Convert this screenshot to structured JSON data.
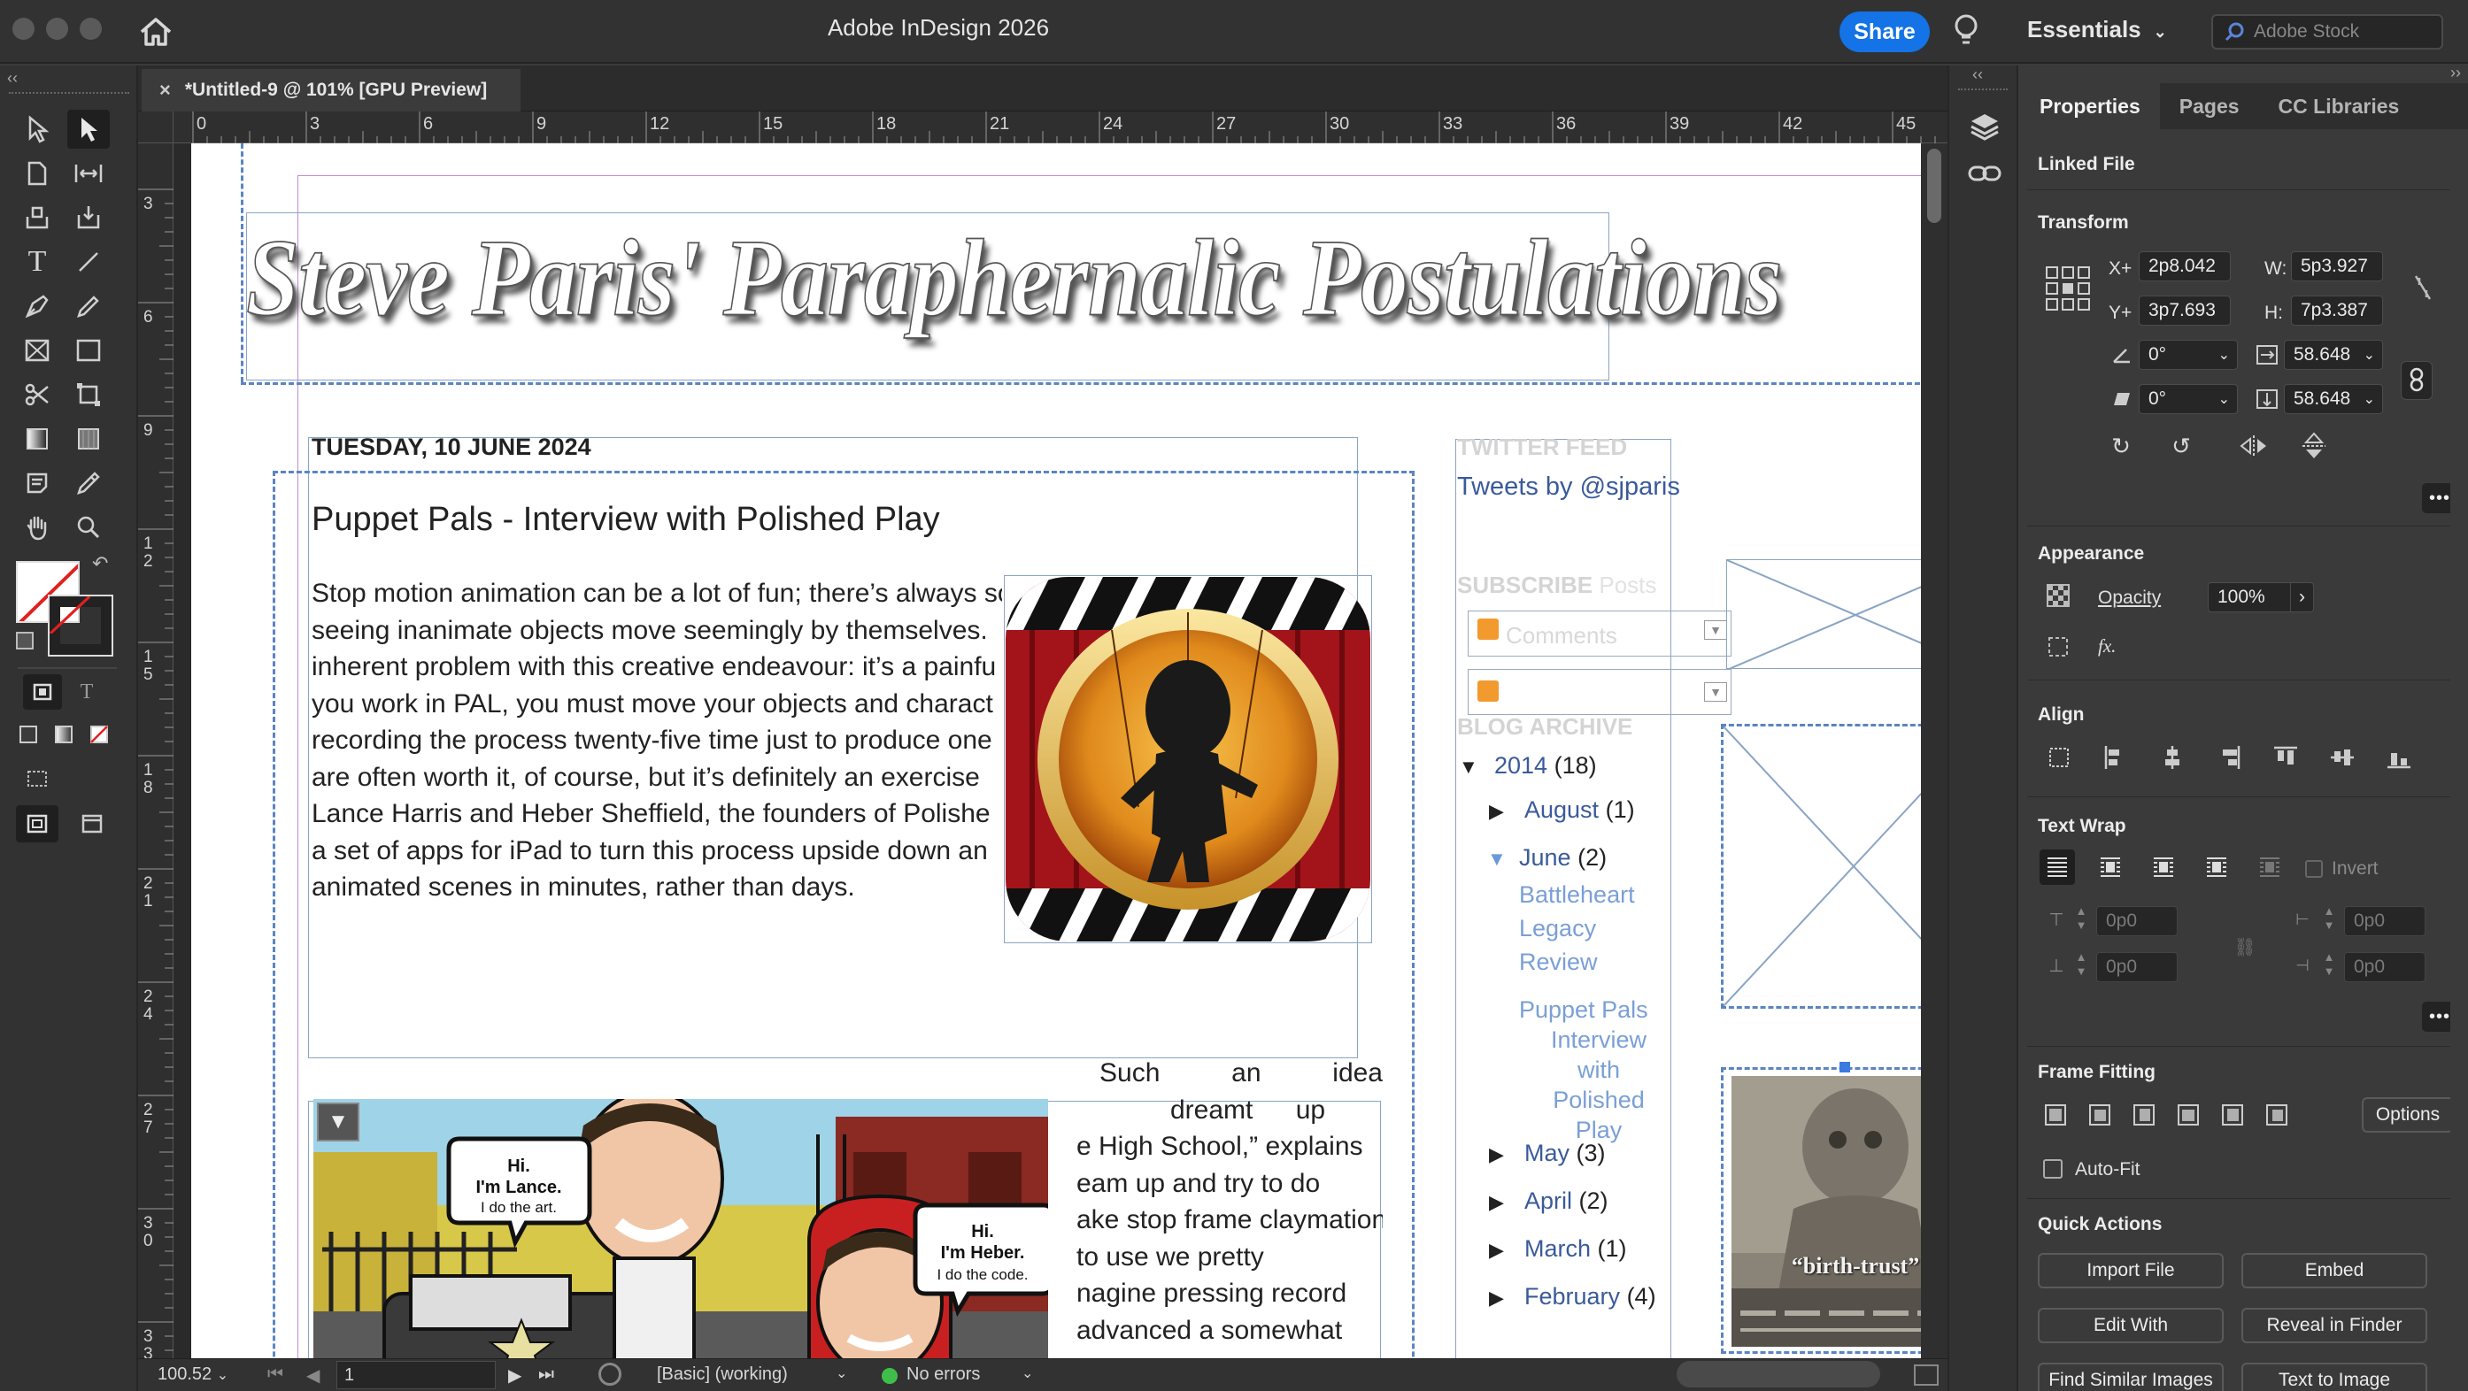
{
  "window": {
    "title": "Adobe InDesign 2026",
    "share": "Share",
    "workspace": "Essentials",
    "stock_placeholder": "Adobe Stock"
  },
  "document": {
    "tab_title": "*Untitled-9 @ 101% [GPU Preview]",
    "ruler_h": [
      "0",
      "3",
      "6",
      "9",
      "12",
      "15",
      "18",
      "21",
      "24",
      "27",
      "30",
      "33",
      "36",
      "39",
      "42",
      "45"
    ],
    "ruler_v": [
      "3",
      "6",
      "9",
      "12",
      "15",
      "18",
      "21",
      "24",
      "27",
      "30",
      "33"
    ]
  },
  "blog": {
    "header_title": "Steve Paris' Paraphernalic Postulations",
    "date": "TUESDAY, 10 JUNE 2024",
    "post_title": "Puppet Pals - Interview with Polished Play",
    "body_lines": [
      "Stop motion animation can be a lot of fun; there’s always so",
      "seeing inanimate objects move seemingly by themselves.",
      "inherent problem with this creative endeavour: it’s a painfu",
      "you work in PAL, you must move your objects and charact",
      "recording the process twenty-five time just to produce one",
      "are often worth it, of course, but it’s definitely an exercise",
      "Lance Harris and Heber Sheffield, the founders of Polishe",
      "a set of apps for iPad to turn this process upside down an",
      "animated scenes in minutes, rather than days."
    ],
    "body2_lines": [
      "Such an idea",
      "dreamt up",
      "e High School,” explains",
      "eam up and try to do",
      "ake stop frame claymation",
      "to use we pretty",
      "nagine pressing record",
      "advanced a somewhat"
    ],
    "speech1_l1": "Hi.",
    "speech1_l2": "I'm Lance.",
    "speech1_l3": "I do the art.",
    "speech2_l1": "Hi.",
    "speech2_l2": "I'm Heber.",
    "speech2_l3": "I do the code.",
    "sidebar": {
      "twitter_heading": "TWITTER FEED",
      "tweets": "Tweets by @sjparis",
      "subscribe": "SUBSCRIBE",
      "subscribe_posts": "Posts",
      "comments": "Comments",
      "archive_heading": "BLOG ARCHIVE",
      "year": "2014",
      "year_count": "(18)",
      "august": "August",
      "august_count": "(1)",
      "june": "June",
      "june_count": "(2)",
      "post1": [
        "Battleheart",
        "Legacy",
        "Review"
      ],
      "post2": [
        "Puppet Pals",
        "Interview",
        "with",
        "Polished",
        "Play"
      ],
      "may": "May",
      "may_count": "(3)",
      "april": "April",
      "april_count": "(2)",
      "march": "March",
      "march_count": "(1)",
      "february": "February",
      "february_count": "(4)"
    },
    "poster_caption": "“birth-trust”"
  },
  "status": {
    "zoom": "100.52",
    "page": "1",
    "style": "[Basic] (working)",
    "errors": "No errors"
  },
  "panel": {
    "tabs": [
      "Properties",
      "Pages",
      "CC Libraries"
    ],
    "linked_file": "Linked File",
    "transform": "Transform",
    "x_label": "X+",
    "x": "2p8.042",
    "y_label": "Y+",
    "y": "3p7.693",
    "w_label": "W:",
    "w": "5p3.927",
    "h_label": "H:",
    "h": "7p3.387",
    "rotate": "0°",
    "shear": "0°",
    "scale_x": "58.648",
    "scale_y": "58.648",
    "appearance": "Appearance",
    "opacity_label": "Opacity",
    "opacity": "100%",
    "fx": "fx.",
    "align": "Align",
    "text_wrap": "Text Wrap",
    "invert": "Invert",
    "wrap_top": "0p0",
    "wrap_bottom": "0p0",
    "wrap_left": "0p0",
    "wrap_right": "0p0",
    "frame_fitting": "Frame Fitting",
    "options": "Options",
    "auto_fit": "Auto-Fit",
    "quick_actions": "Quick Actions",
    "import_file": "Import File",
    "embed": "Embed",
    "edit_with": "Edit With",
    "reveal": "Reveal in Finder",
    "find_similar": "Find Similar Images",
    "text_to_image": "Text to Image"
  },
  "colors": {
    "accent": "#1473e6",
    "frame_blue": "#5b84c4",
    "link_blue": "#3a5a9a"
  }
}
